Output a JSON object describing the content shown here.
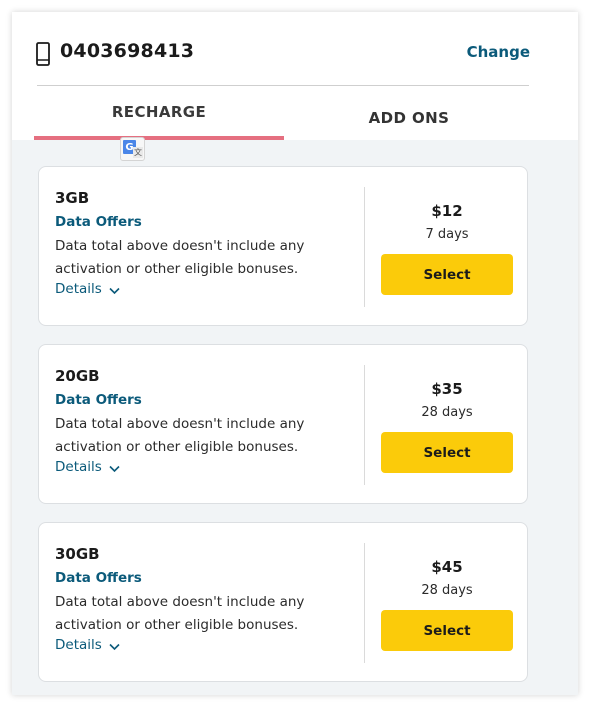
{
  "header": {
    "phone_number": "0403698413",
    "change_label": "Change"
  },
  "tabs": [
    {
      "label": "RECHARGE",
      "active": true
    },
    {
      "label": "ADD ONS",
      "active": false
    }
  ],
  "colors": {
    "accent_link": "#0b5a7a",
    "active_tab_underline": "#e56f80",
    "select_button": "#fbcb0a",
    "content_background": "#f1f4f6"
  },
  "offers": [
    {
      "data": "3GB",
      "category": "Data Offers",
      "description": "Data total above doesn't include any activation or other eligible bonuses.",
      "details_label": "Details",
      "price": "$12",
      "duration": "7 days",
      "select_label": "Select"
    },
    {
      "data": "20GB",
      "category": "Data Offers",
      "description": "Data total above doesn't include any activation or other eligible bonuses.",
      "details_label": "Details",
      "price": "$35",
      "duration": "28 days",
      "select_label": "Select"
    },
    {
      "data": "30GB",
      "category": "Data Offers",
      "description": "Data total above doesn't include any activation or other eligible bonuses.",
      "details_label": "Details",
      "price": "$45",
      "duration": "28 days",
      "select_label": "Select"
    }
  ]
}
